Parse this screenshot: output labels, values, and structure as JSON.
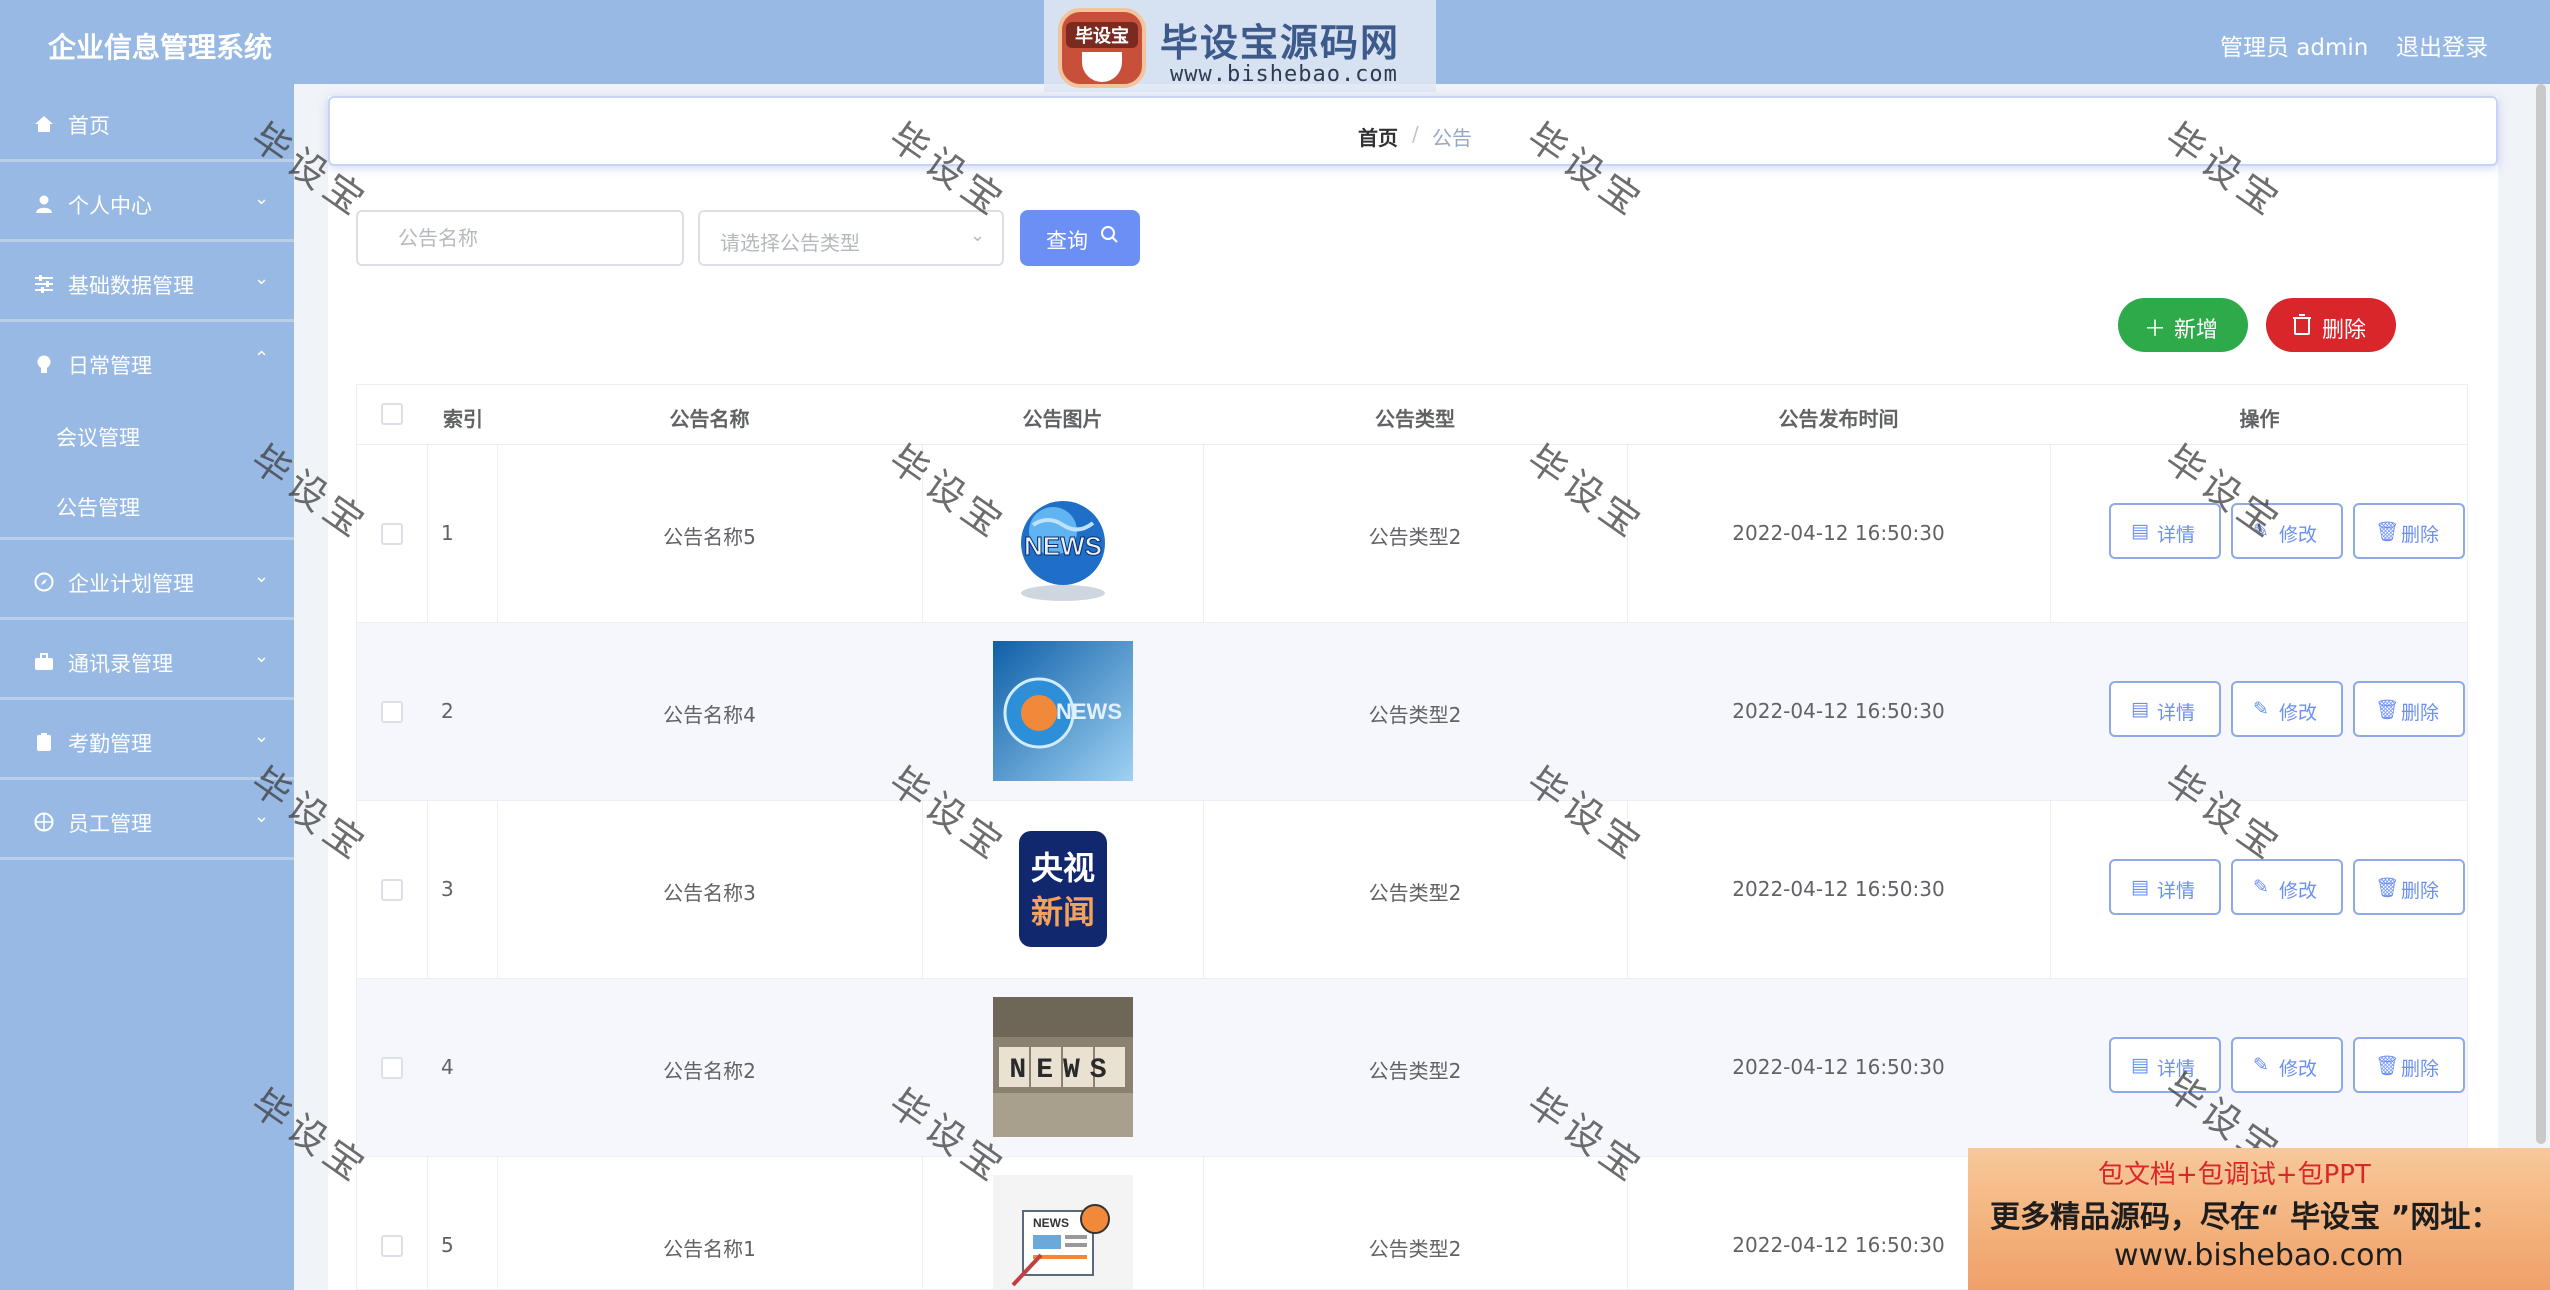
{
  "header": {
    "app_title": "企业信息管理系统",
    "user_label": "管理员 admin",
    "logout_label": "退出登录"
  },
  "brand": {
    "badge": "毕设宝",
    "name": "毕设宝源码网",
    "url": "www.bishebao.com"
  },
  "sidebar": {
    "items": [
      {
        "label": "首页",
        "icon": "home-icon"
      },
      {
        "label": "个人中心",
        "icon": "user-icon"
      },
      {
        "label": "基础数据管理",
        "icon": "sliders-icon"
      },
      {
        "label": "日常管理",
        "icon": "bulb-icon"
      },
      {
        "label": "会议管理"
      },
      {
        "label": "公告管理"
      },
      {
        "label": "企业计划管理",
        "icon": "compass-icon"
      },
      {
        "label": "通讯录管理",
        "icon": "briefcase-icon"
      },
      {
        "label": "考勤管理",
        "icon": "clipboard-icon"
      },
      {
        "label": "员工管理",
        "icon": "basketball-icon"
      }
    ]
  },
  "breadcrumb": {
    "home": "首页",
    "sep": "/",
    "current": "公告"
  },
  "search": {
    "name_placeholder": "公告名称",
    "type_placeholder": "请选择公告类型",
    "query_label": "查询"
  },
  "actions": {
    "add_label": "新增",
    "delete_label": "删除"
  },
  "table": {
    "headers": [
      "索引",
      "公告名称",
      "公告图片",
      "公告类型",
      "公告发布时间",
      "操作"
    ],
    "op_labels": {
      "detail": "详情",
      "edit": "修改",
      "delete": "删除"
    },
    "rows": [
      {
        "index": "1",
        "name": "公告名称5",
        "image": "globe-news",
        "type": "公告类型2",
        "time": "2022-04-12 16:50:30"
      },
      {
        "index": "2",
        "name": "公告名称4",
        "image": "blue-news",
        "type": "公告类型2",
        "time": "2022-04-12 16:50:30"
      },
      {
        "index": "3",
        "name": "公告名称3",
        "image": "cctv-news",
        "type": "公告类型2",
        "time": "2022-04-12 16:50:30"
      },
      {
        "index": "4",
        "name": "公告名称2",
        "image": "news-blocks",
        "type": "公告类型2",
        "time": "2022-04-12 16:50:30"
      },
      {
        "index": "5",
        "name": "公告名称1",
        "image": "newspaper",
        "type": "公告类型2",
        "time": "2022-04-12 16:50:30"
      }
    ]
  },
  "thumb_text": {
    "globe": "NEWS",
    "blue": "NEWS",
    "cctv_top": "央视",
    "cctv_bottom": "新闻",
    "blocks": "NEWS",
    "paper": "NEWS"
  },
  "watermark_text": "毕设宝",
  "promo": {
    "line1": "包文档+包调试+包PPT",
    "line2": "更多精品源码，尽在“ 毕设宝 ”网址：",
    "line3": "www.bishebao.com"
  },
  "colors": {
    "header_bg": "#98b9e3",
    "accent": "#6b8ff5",
    "add_green": "#2eaa4a",
    "delete_red": "#d9262a"
  }
}
